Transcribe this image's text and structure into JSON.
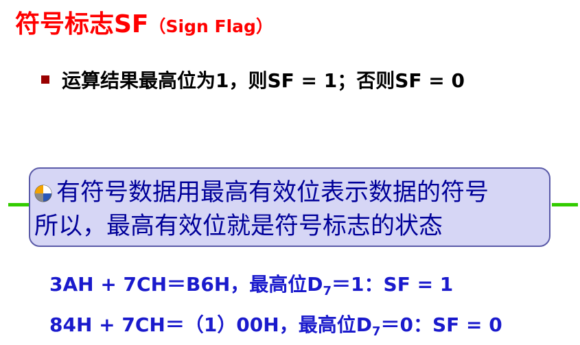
{
  "title": {
    "main": "符号标志SF",
    "sub": "（Sign Flag）"
  },
  "bullet": {
    "text": "运算结果最高位为1，则SF = 1；否则SF = 0"
  },
  "callout": {
    "icon": "pie-chart-icon",
    "line1": "有符号数据用最高有效位表示数据的符号",
    "line2": "所以，最高有效位就是符号标志的状态"
  },
  "examples": [
    {
      "prefix": "3AH + 7CH＝B6H，最高位D",
      "subscript": "7",
      "suffix": "＝1：SF = 1"
    },
    {
      "prefix": "84H + 7CH＝（1）00H，最高位D",
      "subscript": "7",
      "suffix": "＝0：SF = 0"
    }
  ],
  "colors": {
    "title": "#ff0000",
    "bullet_marker": "#990000",
    "callout_background": "#d6d6f5",
    "callout_text": "#000099",
    "example_text": "#1a1acc",
    "accent_line": "#33cc00"
  }
}
